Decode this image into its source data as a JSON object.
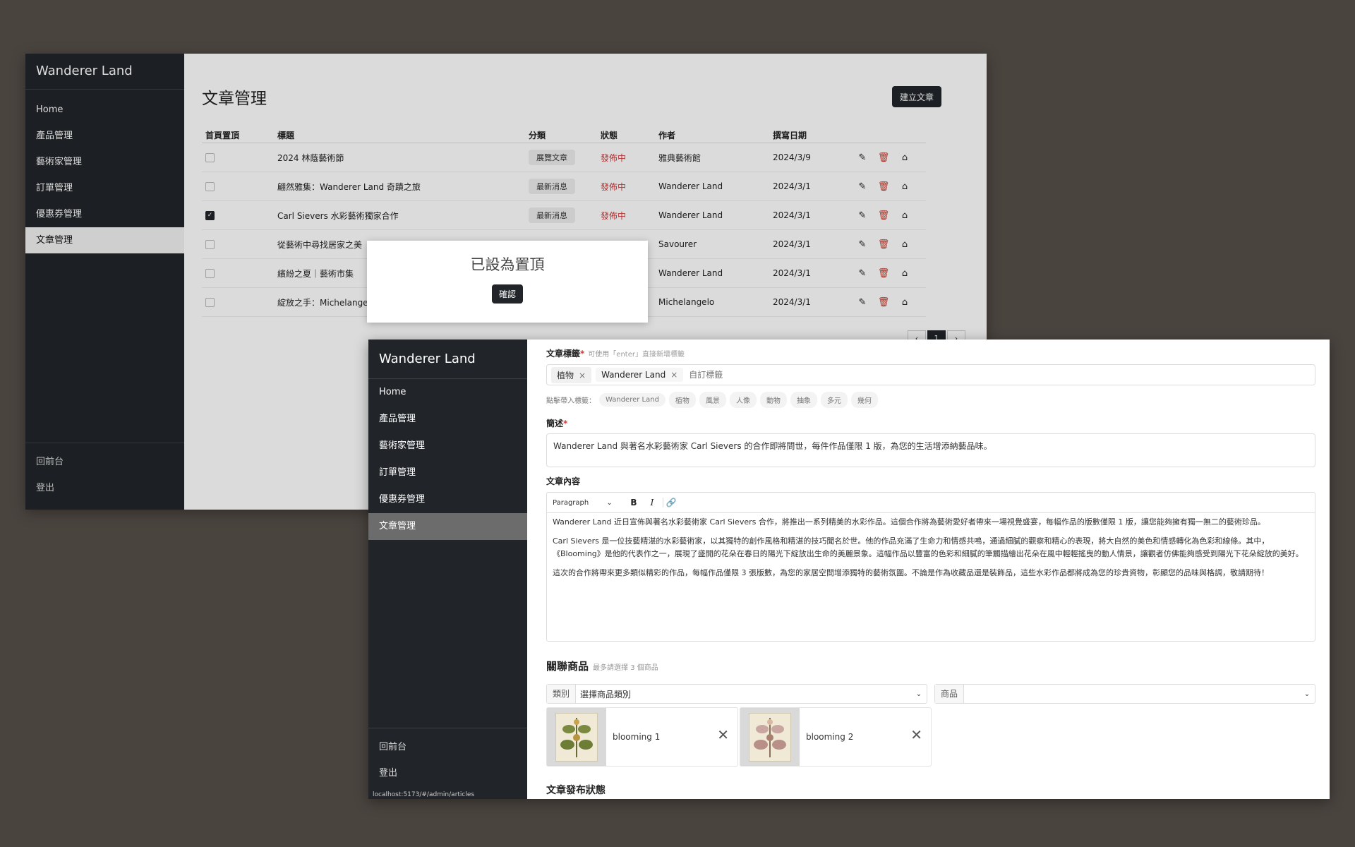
{
  "app": {
    "brand": "Wanderer Land"
  },
  "sidebar": {
    "items": [
      "Home",
      "產品管理",
      "藝術家管理",
      "訂單管理",
      "優惠券管理",
      "文章管理"
    ],
    "active": "文章管理",
    "bottom": [
      "回前台",
      "登出"
    ]
  },
  "list_page": {
    "title": "文章管理",
    "create_button": "建立文章",
    "columns": [
      "首頁置頂",
      "標題",
      "分類",
      "狀態",
      "作者",
      "撰寫日期"
    ],
    "rows": [
      {
        "pinned": false,
        "title": "2024 林蔭藝術節",
        "category": "展覽文章",
        "status": "發佈中",
        "author": "雅典藝術館",
        "date": "2024/3/9"
      },
      {
        "pinned": false,
        "title": "翩然雅集：Wanderer Land 奇蹟之旅",
        "category": "最新消息",
        "status": "發佈中",
        "author": "Wanderer Land",
        "date": "2024/3/1"
      },
      {
        "pinned": true,
        "title": "Carl Sievers 水彩藝術獨家合作",
        "category": "最新消息",
        "status": "發佈中",
        "author": "Wanderer Land",
        "date": "2024/3/1"
      },
      {
        "pinned": false,
        "title": "從藝術中尋找居家之美",
        "category": "",
        "status": "",
        "author": "Savourer",
        "date": "2024/3/1"
      },
      {
        "pinned": false,
        "title": "繽紛之夏｜藝術市集",
        "category": "",
        "status": "",
        "author": "Wanderer Land",
        "date": "2024/3/1"
      },
      {
        "pinned": false,
        "title": "綻放之手：Michelange",
        "category": "",
        "status": "",
        "author": "Michelangelo",
        "date": "2024/3/1"
      }
    ],
    "pagination": {
      "current": "1",
      "prev": "‹",
      "next": "›"
    }
  },
  "modal": {
    "title": "已設為置頂",
    "confirm": "確認"
  },
  "editor_page": {
    "tags_label": "文章標籤",
    "tags_hint": "可使用「enter」直接新增標籤",
    "tags": [
      "植物",
      "Wanderer Land"
    ],
    "tag_placeholder": "自訂標籤",
    "suggest_label": "點擊帶入標籤：",
    "suggested_tags": [
      "Wanderer Land",
      "植物",
      "風景",
      "人像",
      "動物",
      "抽象",
      "多元",
      "幾何"
    ],
    "desc_label": "簡述",
    "description": "Wanderer Land 與著名水彩藝術家 Carl Sievers 的合作即將問世，每件作品僅限 1 版，為您的生活增添納藝品味。",
    "content_label": "文章內容",
    "toolbar": {
      "paragraph": "Paragraph",
      "bold": "B",
      "italic": "I"
    },
    "content": [
      "Wanderer Land 近日宣佈與著名水彩藝術家 Carl Sievers 合作，將推出一系列精美的水彩作品。這個合作將為藝術愛好者帶來一場視覺盛宴，每幅作品的版數僅限 1 版，讓您能夠擁有獨一無二的藝術珍品。",
      "Carl Sievers 是一位技藝精湛的水彩藝術家，以其獨特的創作風格和精湛的技巧聞名於世。他的作品充滿了生命力和情感共鳴，通過細膩的觀察和精心的表現，將大自然的美色和情感轉化為色彩和線條。其中，《Blooming》是他的代表作之一，展現了盛開的花朵在春日的陽光下綻放出生命的美麗景象。這幅作品以豐富的色彩和細膩的筆觸描繪出花朵在風中輕輕搖曳的動人情景，讓觀者仿佛能夠感受到陽光下花朵綻放的美好。",
      "這次的合作將帶來更多類似精彩的作品，每幅作品僅限 3 張版數，為您的家居空間增添獨特的藝術氛圍。不論是作為收藏品還是裝飾品，這些水彩作品都將成為您的珍貴資物，彰顯您的品味與格調，敬請期待！"
    ],
    "related_title": "關聯商品",
    "related_hint": "最多請選擇 3 個商品",
    "category_select": {
      "label": "類別",
      "placeholder": "選擇商品類別"
    },
    "product_select": {
      "label": "商品",
      "value": ""
    },
    "products": [
      {
        "name": "blooming 1"
      },
      {
        "name": "blooming 2"
      }
    ],
    "publish_title": "文章發布狀態"
  },
  "status_bar_url": "localhost:5173/#/admin/articles"
}
